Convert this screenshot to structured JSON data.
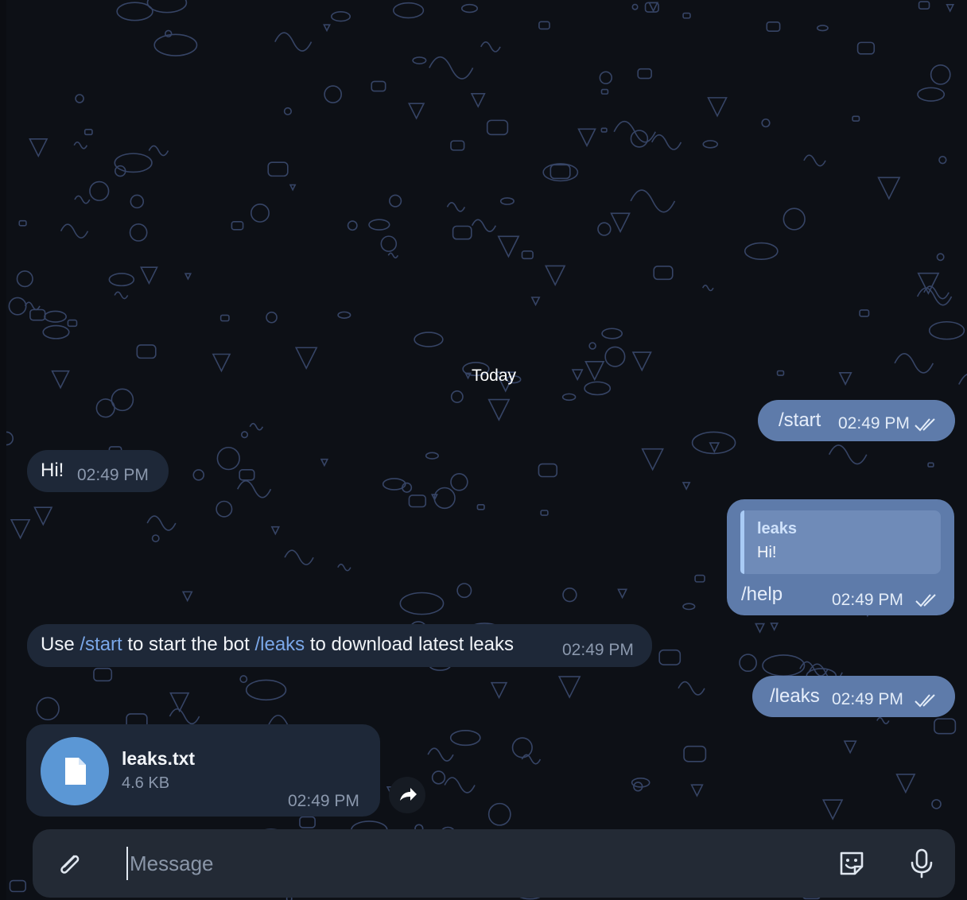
{
  "chat": {
    "date_separator": "Today",
    "messages": [
      {
        "id": "m1",
        "direction": "outgoing",
        "text": "/start",
        "time": "02:49 PM",
        "status": "read"
      },
      {
        "id": "m2",
        "direction": "incoming",
        "text": "Hi!",
        "time": "02:49 PM"
      },
      {
        "id": "m3",
        "direction": "outgoing",
        "reply_to": {
          "author": "leaks",
          "text": "Hi!"
        },
        "text": "/help",
        "time": "02:49 PM",
        "status": "read"
      },
      {
        "id": "m4",
        "direction": "incoming",
        "parts": [
          "Use ",
          "/start",
          " to start the bot ",
          "/leaks",
          " to download latest leaks"
        ],
        "time": "02:49 PM"
      },
      {
        "id": "m5",
        "direction": "outgoing",
        "text": "/leaks",
        "time": "02:49 PM",
        "status": "read"
      },
      {
        "id": "m6",
        "direction": "incoming",
        "file": {
          "name": "leaks.txt",
          "size": "4.6 KB"
        },
        "time": "02:49 PM"
      }
    ]
  },
  "composer": {
    "placeholder": "Message",
    "icons": [
      "paperclip-icon",
      "sticker-icon",
      "microphone-icon"
    ]
  },
  "colors": {
    "incoming_bubble": "#1e2838",
    "outgoing_bubble": "#5e7baa",
    "link": "#7aa7e8",
    "file_icon_bg": "#5b97d5"
  }
}
